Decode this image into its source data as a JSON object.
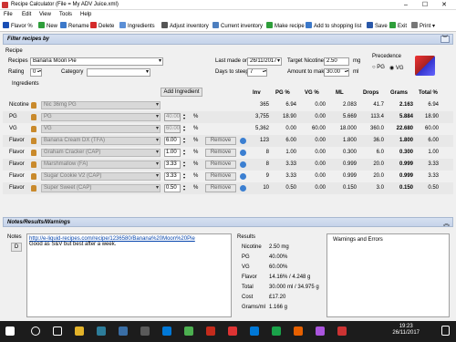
{
  "window": {
    "title": "Recipe Calculator (File = My ADV Juice.xml)",
    "min": "–",
    "max": "☐",
    "close": "✕"
  },
  "menu": [
    "File",
    "Edit",
    "View",
    "Tools",
    "Help"
  ],
  "toolbar": {
    "flavor": "Flavor %",
    "new": "New",
    "rename": "Rename",
    "delete": "Delete",
    "ingredients": "Ingredients",
    "adjust": "Adjust inventory",
    "current": "Current inventory",
    "make": "Make recipe",
    "shopping": "Add to shopping list",
    "save": "Save",
    "exit": "Exit",
    "print": "Print"
  },
  "filter": {
    "label": "Filter recipes by"
  },
  "recipe": {
    "section": "Recipe",
    "recipes_label": "Recipes",
    "recipe_value": "Banana Moon Pie",
    "rating_label": "Rating",
    "rating_value": "0",
    "category_label": "Category",
    "category_value": "",
    "last_made_label": "Last made on",
    "last_made_value": "26/11/2017",
    "steep_label": "Days to steep",
    "steep_value": "7",
    "target_nic_label": "Target Nicotine",
    "target_nic_value": "2.50",
    "target_nic_unit": "mg",
    "amount_label": "Amount to make",
    "amount_value": "30.00",
    "amount_unit": "ml",
    "precedence_label": "Precedence",
    "pg_label": "PG",
    "vg_label": "VG"
  },
  "ingredients": {
    "section": "Ingredients",
    "add_button": "Add Ingredient",
    "headers": {
      "inv": "Inv",
      "pg": "PG %",
      "vg": "VG %",
      "ml": "ML",
      "drops": "Drops",
      "grams": "Grams",
      "total": "Total %"
    },
    "rows": [
      {
        "type": "Nicotine",
        "name": "Nic 36mg PG",
        "pct": "",
        "inv": "365",
        "pg": "6.94",
        "vg": "0.00",
        "ml": "2.083",
        "drops": "41.7",
        "grams": "2.163",
        "total": "6.94",
        "remove": ""
      },
      {
        "type": "PG",
        "name": "PG",
        "pct": "40.00",
        "inv": "3,755",
        "pg": "18.90",
        "vg": "0.00",
        "ml": "5.669",
        "drops": "113.4",
        "grams": "5.884",
        "total": "18.90",
        "remove": ""
      },
      {
        "type": "VG",
        "name": "VG",
        "pct": "60.00",
        "inv": "5,362",
        "pg": "0.00",
        "vg": "60.00",
        "ml": "18.000",
        "drops": "360.0",
        "grams": "22.680",
        "total": "60.00",
        "remove": ""
      },
      {
        "type": "Flavor",
        "name": "Banana Cream DX (TFA)",
        "pct": "6.00",
        "inv": "123",
        "pg": "6.00",
        "vg": "0.00",
        "ml": "1.800",
        "drops": "36.0",
        "grams": "1.800",
        "total": "6.00",
        "remove": "Remove"
      },
      {
        "type": "Flavor",
        "name": "Graham Cracker (CAP)",
        "pct": "1.00",
        "inv": "8",
        "pg": "1.00",
        "vg": "0.00",
        "ml": "0.300",
        "drops": "6.0",
        "grams": "0.300",
        "total": "1.00",
        "remove": "Remove"
      },
      {
        "type": "Flavor",
        "name": "Marshmallow (FA)",
        "pct": "3.33",
        "inv": "8",
        "pg": "3.33",
        "vg": "0.00",
        "ml": "0.999",
        "drops": "20.0",
        "grams": "0.999",
        "total": "3.33",
        "remove": "Remove"
      },
      {
        "type": "Flavor",
        "name": "Sugar Cookie V2 (CAP)",
        "pct": "3.33",
        "inv": "9",
        "pg": "3.33",
        "vg": "0.00",
        "ml": "0.999",
        "drops": "20.0",
        "grams": "0.999",
        "total": "3.33",
        "remove": "Remove"
      },
      {
        "type": "Flavor",
        "name": "Super Sweet (CAP)",
        "pct": "0.50",
        "inv": "10",
        "pg": "0.50",
        "vg": "0.00",
        "ml": "0.150",
        "drops": "3.0",
        "grams": "0.150",
        "total": "0.50",
        "remove": "Remove"
      }
    ]
  },
  "notes": {
    "section": "Notes/Results/Warnings",
    "notes_label": "Notes",
    "link": "http://e-liquid-recipes.com/recipe/1236580/Banana%20Moon%20Pie",
    "text": "Good as S&V but best after a week.",
    "d_button": "D",
    "results_label": "Results",
    "results": [
      {
        "k": "Nicotine",
        "v": "2.50 mg"
      },
      {
        "k": "PG",
        "v": "40.00%"
      },
      {
        "k": "VG",
        "v": "60.00%"
      },
      {
        "k": "Flavor",
        "v": "14.16% / 4.248 g"
      },
      {
        "k": "Total",
        "v": "30.000 ml / 34.975 g"
      },
      {
        "k": "Cost",
        "v": "£17.20"
      },
      {
        "k": "Grams/ml",
        "v": "1.166 g"
      }
    ],
    "warnings_label": "Warnings and Errors"
  },
  "taskbar": {
    "time": "19:23",
    "date": "26/11/2017"
  }
}
